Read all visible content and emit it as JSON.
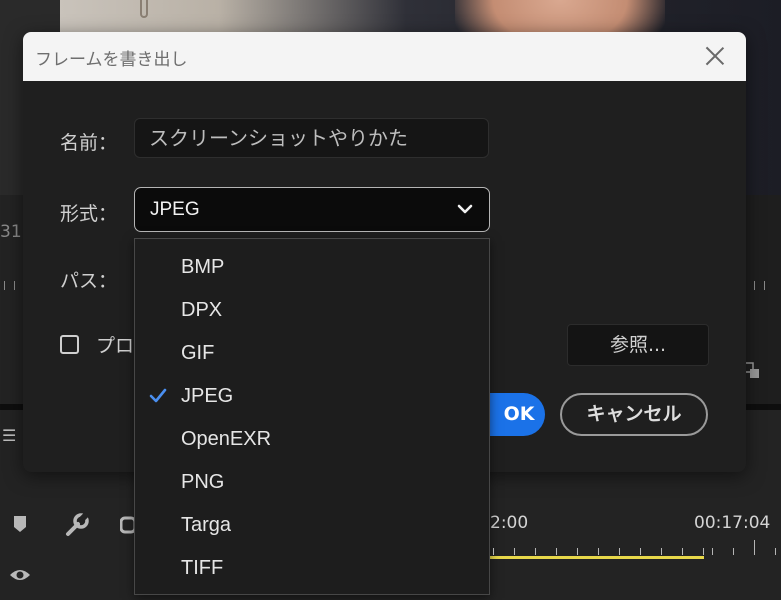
{
  "dialog": {
    "title": "フレームを書き出し",
    "name_label": "名前：",
    "name_value": "スクリーンショットやりかた",
    "format_label": "形式：",
    "format_value": "JPEG",
    "path_label": "パス：",
    "import_label": "プロ",
    "browse_label": "参照...",
    "ok_label": "OK",
    "cancel_label": "キャンセル"
  },
  "dropdown": {
    "options": [
      "BMP",
      "DPX",
      "GIF",
      "JPEG",
      "OpenEXR",
      "PNG",
      "Targa",
      "TIFF"
    ],
    "selected": "JPEG"
  },
  "background": {
    "timecode_left_partial": "31",
    "timecode_a": "2:00",
    "timecode_b": "00:17:04"
  },
  "icons": {
    "close": "close-icon",
    "chevron": "chevron-down-icon",
    "check": "check-icon"
  },
  "colors": {
    "accent": "#1b72e8",
    "check": "#4a8ff0",
    "timeline_yellow": "#e8d84a"
  }
}
